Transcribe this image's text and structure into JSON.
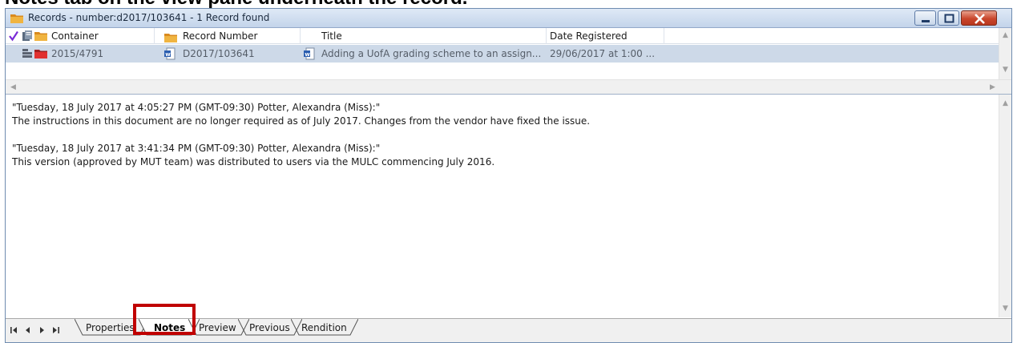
{
  "caption": "Notes tab on the view pane underneath the record.",
  "window": {
    "title": "Records - number:d2017/103641 - 1 Record found",
    "controls": {
      "minimize": "minimize",
      "maximize": "maximize",
      "close": "close"
    }
  },
  "grid": {
    "columns": [
      "Container",
      "Record Number",
      "Title",
      "Date Registered"
    ],
    "rows": [
      {
        "container": "2015/4791",
        "record_number": "D2017/103641",
        "title": "Adding a UofA grading scheme to an assign...",
        "date_registered": "29/06/2017 at 1:00 ..."
      }
    ]
  },
  "notes": [
    {
      "header": "\"Tuesday, 18 July 2017 at 4:05:27 PM (GMT-09:30)   Potter, Alexandra (Miss):\"",
      "body": "The instructions in this document are no longer required as of July 2017. Changes from the vendor have fixed the issue."
    },
    {
      "header": "\"Tuesday, 18 July 2017 at 3:41:34 PM (GMT-09:30)   Potter, Alexandra (Miss):\"",
      "body": "This version (approved by MUT team) was distributed to users via the MULC commencing July 2016."
    }
  ],
  "tabs": [
    "Properties",
    "Notes",
    "Preview",
    "Previous",
    "Rendition"
  ],
  "active_tab": "Notes",
  "colors": {
    "highlight": "#c00000",
    "selected_row": "#cdd9e8",
    "titlebar": "#c3d4ea",
    "checkmark": "#7a2bd6"
  },
  "icons": {
    "checkmark": "checkmark-icon",
    "folder": "folder-icon",
    "word_doc": "word-document-icon"
  }
}
